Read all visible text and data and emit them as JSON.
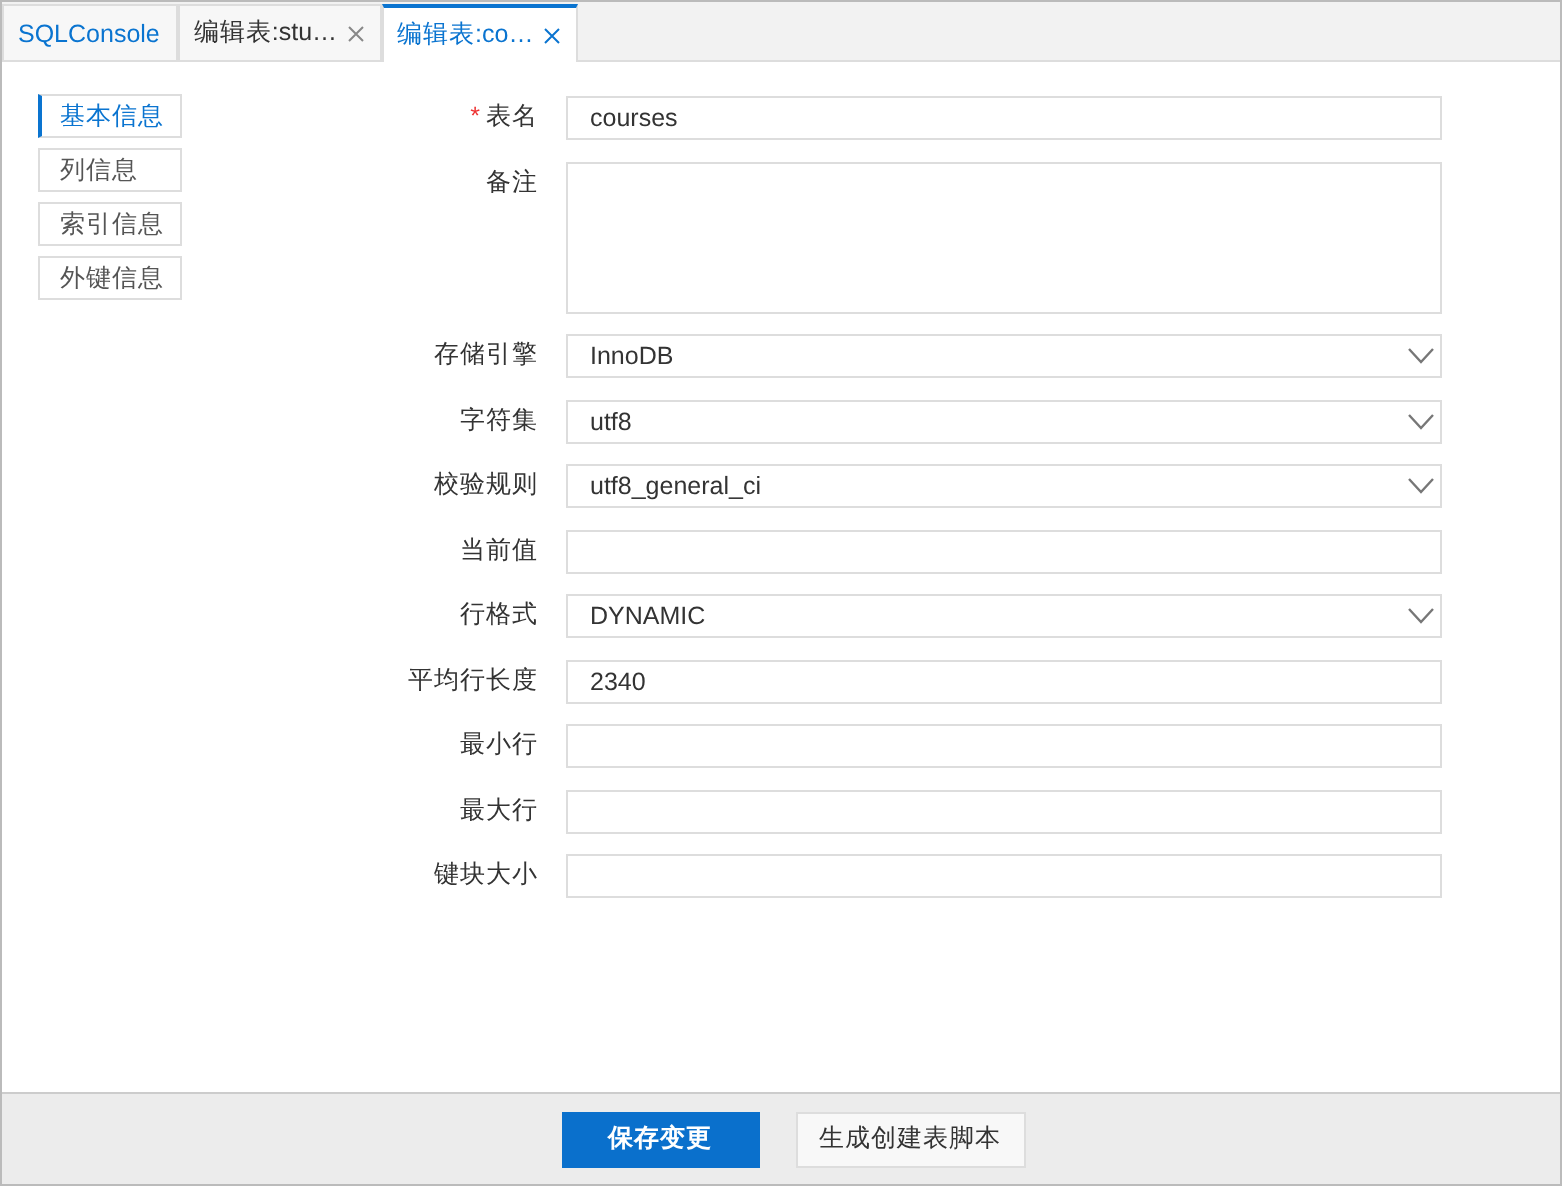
{
  "tabs": [
    {
      "label": "SQLConsole",
      "kind": "console",
      "closable": false,
      "selected": false
    },
    {
      "label": "编辑表:stu…",
      "kind": "table",
      "closable": true,
      "selected": false
    },
    {
      "label": "编辑表:co…",
      "kind": "table",
      "closable": true,
      "selected": true
    }
  ],
  "sidebar": {
    "items": [
      {
        "label": "基本信息",
        "selected": true
      },
      {
        "label": "列信息",
        "selected": false
      },
      {
        "label": "索引信息",
        "selected": false
      },
      {
        "label": "外键信息",
        "selected": false
      }
    ]
  },
  "form": {
    "fields": [
      {
        "label": "表名",
        "kind": "text",
        "required_mark": "*",
        "value": "courses"
      },
      {
        "label": "备注",
        "kind": "textarea"
      },
      {
        "label": "存储引擎",
        "kind": "select",
        "value": "InnoDB"
      },
      {
        "label": "字符集",
        "kind": "select",
        "value": "utf8"
      },
      {
        "label": "校验规则",
        "kind": "select",
        "value": "utf8_general_ci"
      },
      {
        "label": "当前值",
        "kind": "text"
      },
      {
        "label": "行格式",
        "kind": "select",
        "value": "DYNAMIC"
      },
      {
        "label": "平均行长度",
        "kind": "text",
        "value": "2340"
      },
      {
        "label": "最小行",
        "kind": "text"
      },
      {
        "label": "最大行",
        "kind": "text"
      },
      {
        "label": "键块大小",
        "kind": "text"
      }
    ]
  },
  "buttons": [
    {
      "label": "保存变更",
      "kind": "primary"
    },
    {
      "label": "生成创建表脚本",
      "kind": "secondary"
    }
  ]
}
